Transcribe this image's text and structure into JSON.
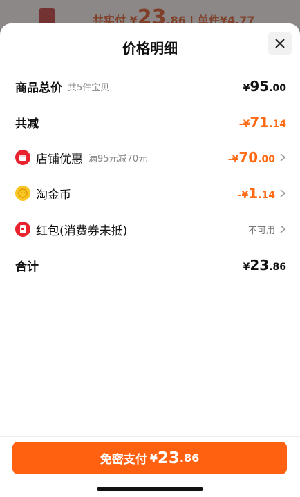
{
  "background": {
    "summary_prefix": "共实付",
    "currency": "¥",
    "amount_int": "23",
    "amount_dec": ".86",
    "unit_price": "| 单件¥4.77"
  },
  "sheet": {
    "title": "价格明细",
    "close_icon": "close-icon"
  },
  "rows": {
    "total": {
      "label": "商品总价",
      "sub": "共5件宝贝",
      "yen": "¥",
      "int": "95",
      "dec": ".00"
    },
    "reduction": {
      "label": "共减",
      "yen": "-¥",
      "int": "71",
      "dec": ".14"
    },
    "shop_discount": {
      "label": "店铺优惠",
      "sub": "满95元减70元",
      "yen": "-¥",
      "int": "70",
      "dec": ".00",
      "icon": "shop-icon"
    },
    "tao_coin": {
      "label": "淘金币",
      "yen": "-¥",
      "int": "1",
      "dec": ".14",
      "icon": "coin-icon"
    },
    "red_packet": {
      "label": "红包(消费券未抵)",
      "status": "不可用",
      "icon": "red-packet-icon"
    },
    "sum": {
      "label": "合计",
      "yen": "¥",
      "int": "23",
      "dec": ".86"
    }
  },
  "pay_button": {
    "label": "免密支付",
    "yen": "¥",
    "int": "23",
    "dec": ".86"
  },
  "colors": {
    "accent": "#ff6a13",
    "button": "#ff6110",
    "red": "#e8232e"
  }
}
